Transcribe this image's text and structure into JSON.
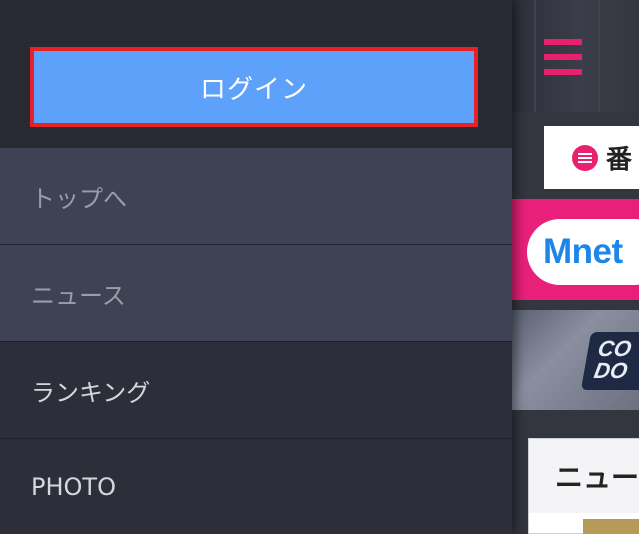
{
  "drawer": {
    "login_label": "ログイン",
    "menu": [
      {
        "label": "トップへ",
        "active": true
      },
      {
        "label": "ニュース",
        "active": true
      },
      {
        "label": "ランキング",
        "active": false
      },
      {
        "label": "PHOTO",
        "active": false
      }
    ]
  },
  "background": {
    "program_button_label": "番",
    "mnet_logo_text": "Mnet",
    "game_logo_text": "CO DO",
    "news_card_title": "ニュー"
  },
  "colors": {
    "login_button_bg": "#5ea1fb",
    "login_button_border": "#e8202a",
    "accent_pink": "#e8206e",
    "mnet_blue": "#1d86e8",
    "drawer_bg": "#2c2f3a",
    "menu_active_bg": "#3e4254"
  },
  "icons": [
    "hamburger-menu-icon",
    "list-icon"
  ]
}
